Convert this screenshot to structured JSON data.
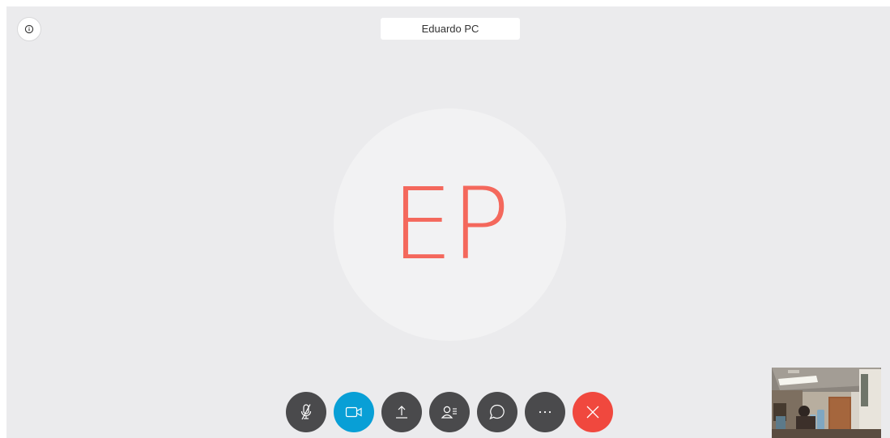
{
  "call": {
    "participant_name": "Eduardo PC",
    "participant_initials": "EP"
  },
  "colors": {
    "initials": "#f4685c",
    "video_active": "#089fd6",
    "end_call": "#f0483e",
    "control_default": "#4a4a4c"
  },
  "controls": [
    {
      "name": "mute-button",
      "icon": "mic-muted-icon"
    },
    {
      "name": "video-button",
      "icon": "video-camera-icon"
    },
    {
      "name": "share-button",
      "icon": "upload-icon"
    },
    {
      "name": "participants-button",
      "icon": "participants-icon"
    },
    {
      "name": "chat-button",
      "icon": "chat-bubble-icon"
    },
    {
      "name": "more-button",
      "icon": "more-dots-icon"
    },
    {
      "name": "end-call-button",
      "icon": "close-icon"
    }
  ],
  "info_icon": "info-icon",
  "self_view": "self-view-video"
}
